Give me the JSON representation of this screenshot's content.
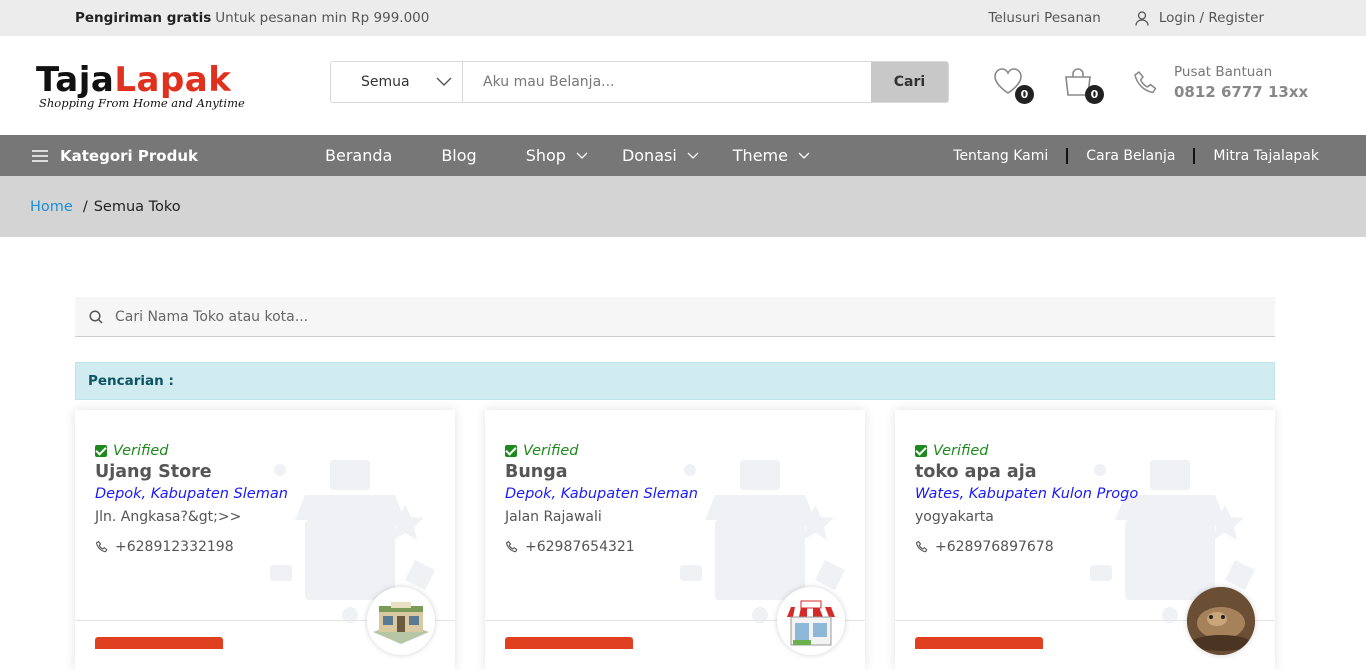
{
  "topbar": {
    "promo_bold": "Pengiriman gratis",
    "promo_text": "Untuk pesanan min Rp 999.000",
    "track": "Telusuri Pesanan",
    "login": "Login",
    "slash": "/",
    "register": "Register"
  },
  "logo": {
    "part1": "Taja",
    "part2": "Lapak",
    "tagline": "Shopping From Home and Anytime"
  },
  "search": {
    "category": "Semua",
    "placeholder": "Aku mau Belanja...",
    "button": "Cari"
  },
  "header": {
    "wishlist_count": "0",
    "cart_count": "0",
    "support_label": "Pusat Bantuan",
    "support_phone": "0812 6777 13xx"
  },
  "nav": {
    "category": "Kategori Produk",
    "items": [
      {
        "label": "Beranda"
      },
      {
        "label": "Blog"
      },
      {
        "label": "Shop"
      },
      {
        "label": "Donasi"
      },
      {
        "label": "Theme"
      }
    ],
    "right": [
      {
        "label": "Tentang Kami"
      },
      {
        "label": "Cara Belanja"
      },
      {
        "label": "Mitra Tajalapak"
      }
    ]
  },
  "breadcrumb": {
    "home": "Home",
    "sep": "/",
    "current": "Semua Toko"
  },
  "store_search": {
    "placeholder": "Cari Nama Toko atau kota..."
  },
  "result_label": "Pencarian :",
  "stores": [
    {
      "verified": "Verified",
      "name": "Ujang Store",
      "location": "Depok, Kabupaten Sleman",
      "address": "Jln. Angkasa?&gt;>>",
      "phone": "+628912332198",
      "avatar": "store-building"
    },
    {
      "verified": "Verified",
      "name": "Bunga",
      "location": "Depok, Kabupaten Sleman",
      "address": "Jalan Rajawali",
      "phone": "+62987654321",
      "avatar": "shop-awning"
    },
    {
      "verified": "Verified",
      "name": "toko apa aja",
      "location": "Wates, Kabupaten Kulon Progo",
      "address": "yogyakarta",
      "phone": "+628976897678",
      "avatar": "animal-photo"
    }
  ],
  "colors": {
    "accent": "#e0311f",
    "nav_bg": "#777777",
    "link": "#1a8fd6",
    "verified": "#1e8a1e",
    "location": "#1a1aff"
  }
}
